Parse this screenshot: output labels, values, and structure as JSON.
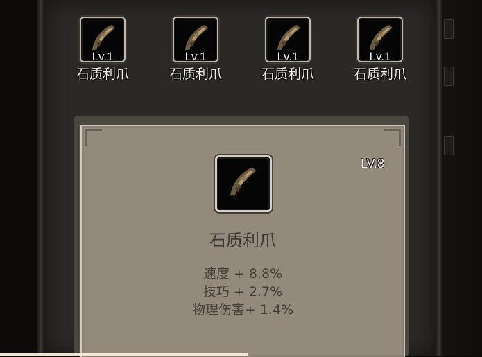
{
  "inventory": {
    "slots": [
      {
        "level": "Lv.1",
        "name": "石质利爪",
        "icon": "claw-icon"
      },
      {
        "level": "Lv.1",
        "name": "石质利爪",
        "icon": "claw-icon"
      },
      {
        "level": "Lv.1",
        "name": "石质利爪",
        "icon": "claw-icon"
      },
      {
        "level": "Lv.1",
        "name": "石质利爪",
        "icon": "claw-icon"
      }
    ]
  },
  "detail": {
    "level": "LV.8",
    "name": "石质利爪",
    "icon": "claw-icon",
    "stats": [
      "速度 + 8.8%",
      "技巧 + 2.7%",
      "物理伤害+ 1.4%"
    ]
  },
  "colors": {
    "card_bg": "#948a7c",
    "panel_bg": "#2b2926",
    "text_light": "#f2efe9",
    "text_dark": "#45403a"
  }
}
